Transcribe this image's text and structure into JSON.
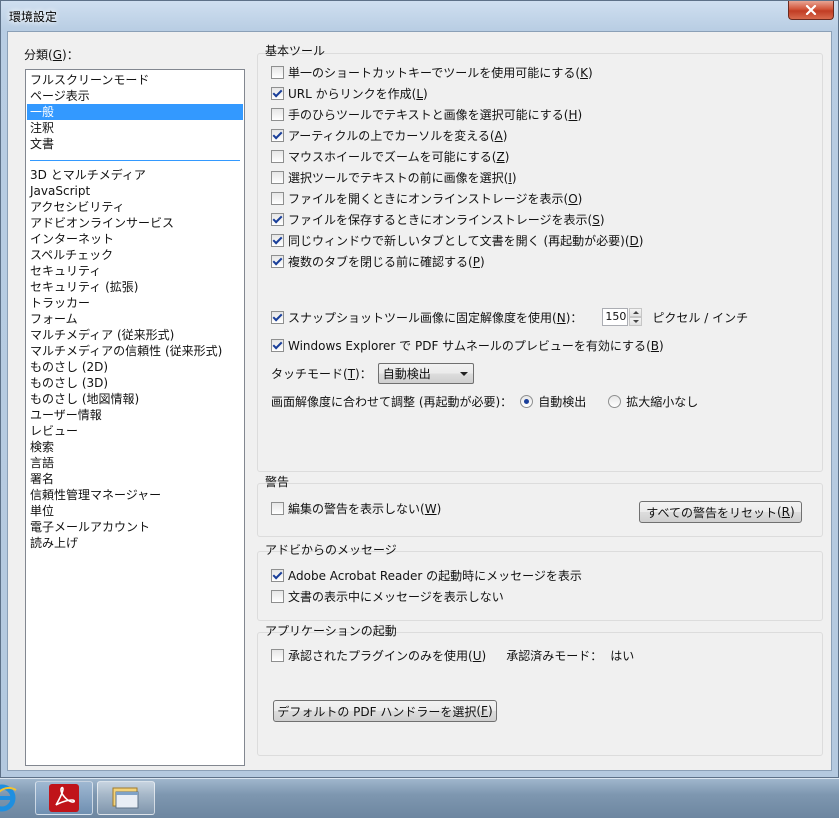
{
  "window": {
    "title": "環境設定"
  },
  "categories": {
    "label": "分類",
    "label_key": "G",
    "label_suffix": "：",
    "group1": [
      "フルスクリーンモード",
      "ページ表示",
      "一般",
      "注釈",
      "文書"
    ],
    "selected": "一般",
    "group2": [
      "3D とマルチメディア",
      "JavaScript",
      "アクセシビリティ",
      "アドビオンラインサービス",
      "インターネット",
      "スペルチェック",
      "セキュリティ",
      "セキュリティ (拡張)",
      "トラッカー",
      "フォーム",
      "マルチメディア (従来形式)",
      "マルチメディアの信頼性 (従来形式)",
      "ものさし (2D)",
      "ものさし (3D)",
      "ものさし (地図情報)",
      "ユーザー情報",
      "レビュー",
      "検索",
      "言語",
      "署名",
      "信頼性管理マネージャー",
      "単位",
      "電子メールアカウント",
      "読み上げ"
    ]
  },
  "basic_tools": {
    "title": "基本ツール",
    "options": [
      {
        "text": "単一のショートカットキーでツールを使用可能にする",
        "key": "K",
        "checked": false
      },
      {
        "text": "URL からリンクを作成",
        "key": "L",
        "checked": true
      },
      {
        "text": "手のひらツールでテキストと画像を選択可能にする",
        "key": "H",
        "checked": false
      },
      {
        "text": "アーティクルの上でカーソルを変える",
        "key": "A",
        "checked": true
      },
      {
        "text": "マウスホイールでズームを可能にする",
        "key": "Z",
        "checked": false
      },
      {
        "text": "選択ツールでテキストの前に画像を選択",
        "key": "I",
        "checked": false
      },
      {
        "text": "ファイルを開くときにオンラインストレージを表示",
        "key": "O",
        "checked": false
      },
      {
        "text": "ファイルを保存するときにオンラインストレージを表示",
        "key": "S",
        "checked": true
      },
      {
        "text": "同じウィンドウで新しいタブとして文書を開く (再起動が必要)",
        "key": "D",
        "checked": true
      },
      {
        "text": "複数のタブを閉じる前に確認する",
        "key": "P",
        "checked": true
      }
    ],
    "snapshot": {
      "text": "スナップショットツール画像に固定解像度を使用",
      "key": "N",
      "suffix": "：",
      "checked": true,
      "value": "150",
      "unit": "ピクセル / インチ"
    },
    "thumbnail": {
      "text": "Windows Explorer で PDF サムネールのプレビューを有効にする",
      "key": "B",
      "checked": true
    },
    "touch_mode": {
      "label": "タッチモード",
      "key": "T",
      "suffix": "：",
      "value": "自動検出"
    },
    "scaling": {
      "label": "画面解像度に合わせて調整 (再起動が必要)：",
      "options": [
        {
          "text": "自動検出",
          "selected": true
        },
        {
          "text": "拡大縮小なし",
          "selected": false
        }
      ]
    }
  },
  "warnings": {
    "title": "警告",
    "option": {
      "text": "編集の警告を表示しない",
      "key": "W",
      "checked": false
    },
    "reset_button": {
      "text": "すべての警告をリセット",
      "key": "R"
    }
  },
  "messages": {
    "title": "アドビからのメッセージ",
    "options": [
      {
        "text": "Adobe Acrobat Reader の起動時にメッセージを表示",
        "key": "",
        "checked": true
      },
      {
        "text": "文書の表示中にメッセージを表示しない",
        "key": "",
        "checked": false
      }
    ]
  },
  "app_startup": {
    "title": "アプリケーションの起動",
    "option": {
      "text": "承認されたプラグインのみを使用",
      "key": "U",
      "checked": false
    },
    "certified_mode_label": "承認済みモード：",
    "certified_mode_value": "はい",
    "handler_button": {
      "text": "デフォルトの PDF ハンドラーを選択",
      "key": "F"
    }
  },
  "colors": {
    "selection": "#3399ff",
    "close_button": "#c84b31",
    "acrobat_red": "#c0141a"
  },
  "taskbar_icons": [
    "internet-explorer-icon",
    "acrobat-reader-icon",
    "window-switch-icon"
  ]
}
